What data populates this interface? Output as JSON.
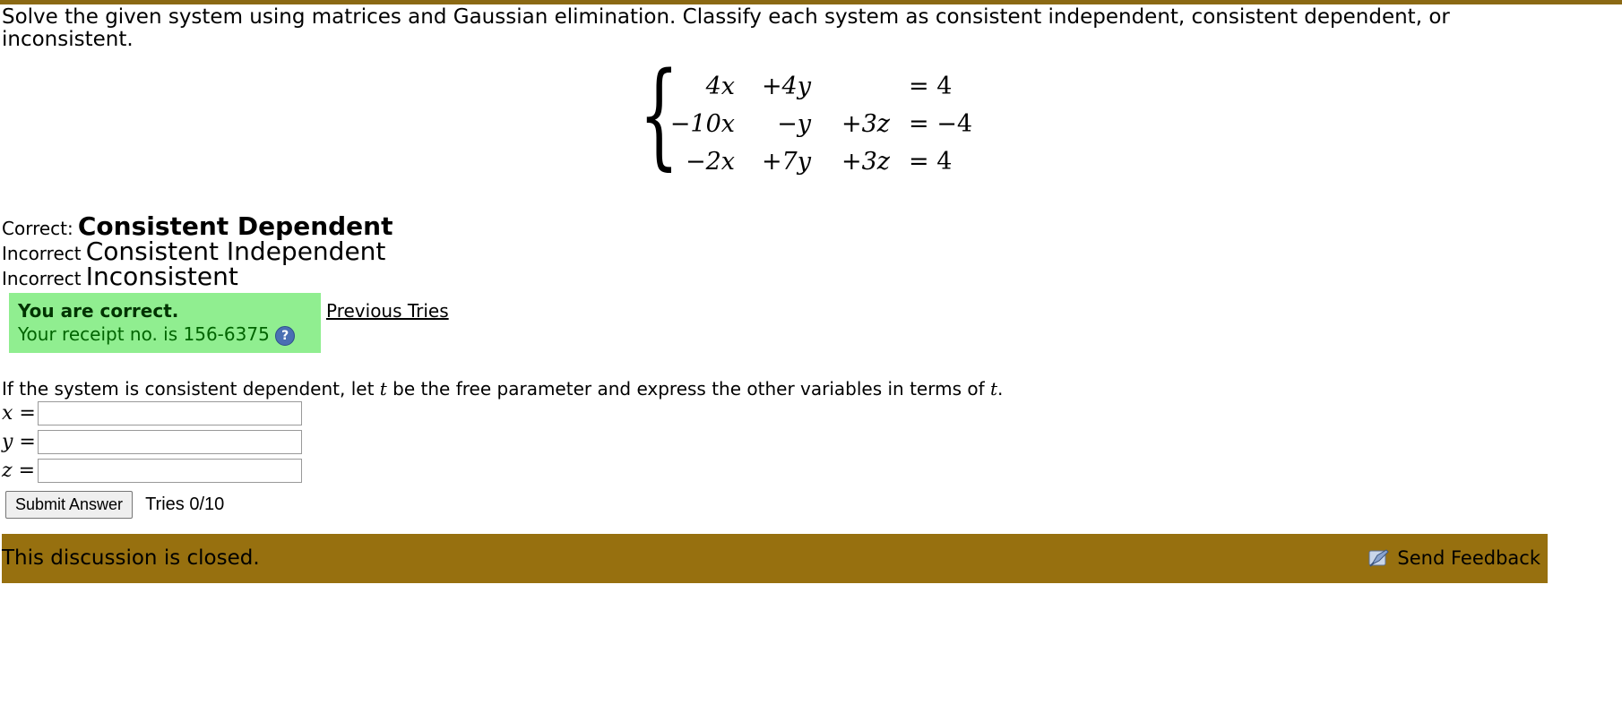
{
  "problem": {
    "instructions": "Solve the given system using matrices and Gaussian elimination. Classify each system as consistent independent, consistent dependent, or inconsistent.",
    "equations": [
      {
        "c1": "4x",
        "c2": "+4y",
        "c3": "",
        "rhs": "= 4"
      },
      {
        "c1": "−10x",
        "c2": "−y",
        "c3": "+3z",
        "rhs": "= −4"
      },
      {
        "c1": "−2x",
        "c2": "+7y",
        "c3": "+3z",
        "rhs": "= 4"
      }
    ]
  },
  "choices": [
    {
      "status": "Correct:",
      "label": "Consistent Dependent"
    },
    {
      "status": "Incorrect",
      "label": "Consistent Independent"
    },
    {
      "status": "Incorrect",
      "label": "Inconsistent"
    }
  ],
  "result": {
    "title": "You are correct.",
    "receipt": "Your receipt no. is 156-6375",
    "help_icon": "?",
    "previous_tries": "Previous Tries"
  },
  "parameter_prompt": {
    "before": "If the system is consistent dependent, let ",
    "var": "t",
    "middle": " be the free parameter and express the other variables in terms of ",
    "end": "."
  },
  "fields": [
    {
      "label": "x =",
      "value": "",
      "placeholder": ""
    },
    {
      "label": "y =",
      "value": "",
      "placeholder": ""
    },
    {
      "label": "z =",
      "value": "",
      "placeholder": ""
    }
  ],
  "submit": {
    "label": "Submit Answer",
    "tries": "Tries 0/10"
  },
  "footer": {
    "closed": "This discussion is closed.",
    "feedback": "Send Feedback"
  },
  "colors": {
    "header_rule": "#8b6914",
    "footer_bar": "#97700f",
    "success_bg": "#90ee90"
  }
}
